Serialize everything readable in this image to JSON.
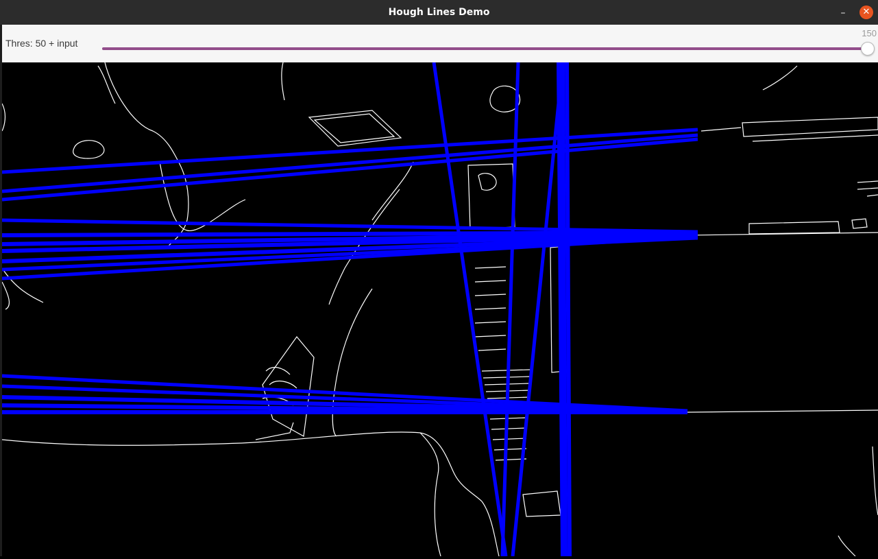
{
  "window": {
    "title": "Hough Lines Demo",
    "minimize_glyph": "–",
    "close_glyph": "✕"
  },
  "trackbar": {
    "label": "Thres: 50 + input",
    "value": "150",
    "fill_fraction": 1.0,
    "accent_color": "#924d8b"
  },
  "image": {
    "description_icon": "edge-detection-canvas",
    "edge_color": "#ffffff",
    "line_color": "#0000ff",
    "background_color": "#000000"
  }
}
